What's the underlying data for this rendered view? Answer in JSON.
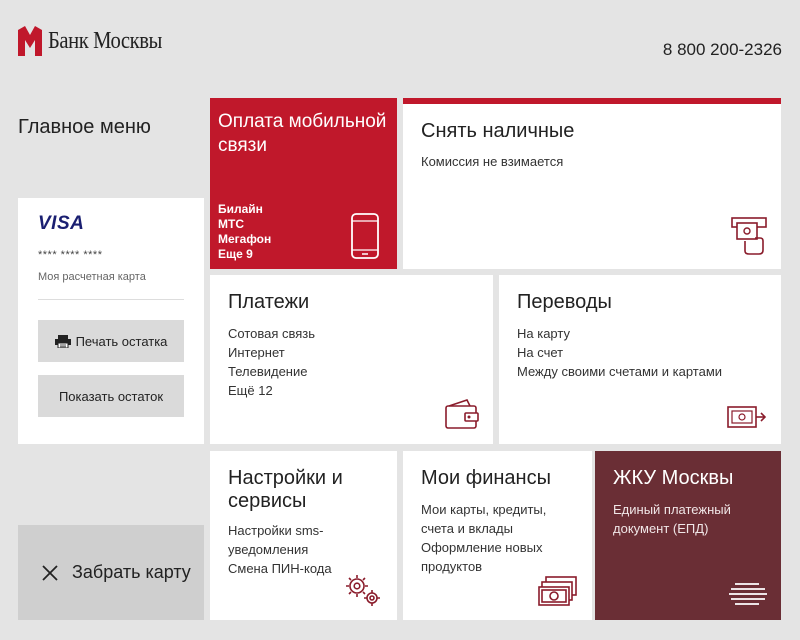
{
  "header": {
    "logo_text": "Банк Москвы",
    "phone": "8 800 200-2326"
  },
  "sidebar": {
    "title": "Главное меню",
    "card": {
      "brand": "VISA",
      "number": "**** **** ****",
      "caption": "Моя расчетная карта"
    },
    "print_balance_label": "Печать остатка",
    "show_balance_label": "Показать остаток",
    "take_card_label": "Забрать карту"
  },
  "tiles": {
    "mobile": {
      "title": "Оплата мобильной связи",
      "lines": [
        "Билайн",
        "МТС",
        "Мегафон",
        "Еще 9"
      ]
    },
    "cash": {
      "title": "Снять наличные",
      "lines": [
        "Комиссия не взимается"
      ]
    },
    "payments": {
      "title": "Платежи",
      "lines": [
        "Сотовая связь",
        "Интернет",
        "Телевидение",
        "Ещё 12"
      ]
    },
    "transfers": {
      "title": "Переводы",
      "lines": [
        "На карту",
        "На счет",
        "Между своими счетами и картами"
      ]
    },
    "settings": {
      "title": "Настройки и сервисы",
      "lines": [
        "Настройки sms-",
        "уведомления",
        "Смена ПИН-кода"
      ]
    },
    "finance": {
      "title": "Мои финансы",
      "lines": [
        "Мои карты, кредиты,",
        "счета и вклады",
        "Оформление новых",
        "продуктов"
      ]
    },
    "housing": {
      "title": "ЖКУ Москвы",
      "lines": [
        "Единый платежный",
        "документ (ЕПД)"
      ]
    }
  },
  "icons": {
    "logo": "bank-logo-icon",
    "print": "printer-icon",
    "close": "close-icon",
    "phone": "mobile-phone-icon",
    "atm": "atm-cash-icon",
    "wallet": "wallet-icon",
    "transfer": "money-transfer-icon",
    "gears": "gears-icon",
    "money": "banknotes-icon",
    "housing": "lines-icon"
  },
  "colors": {
    "brand_red": "#c0182b",
    "housing_tile": "#6a2e35",
    "background": "#e4e4e4"
  }
}
